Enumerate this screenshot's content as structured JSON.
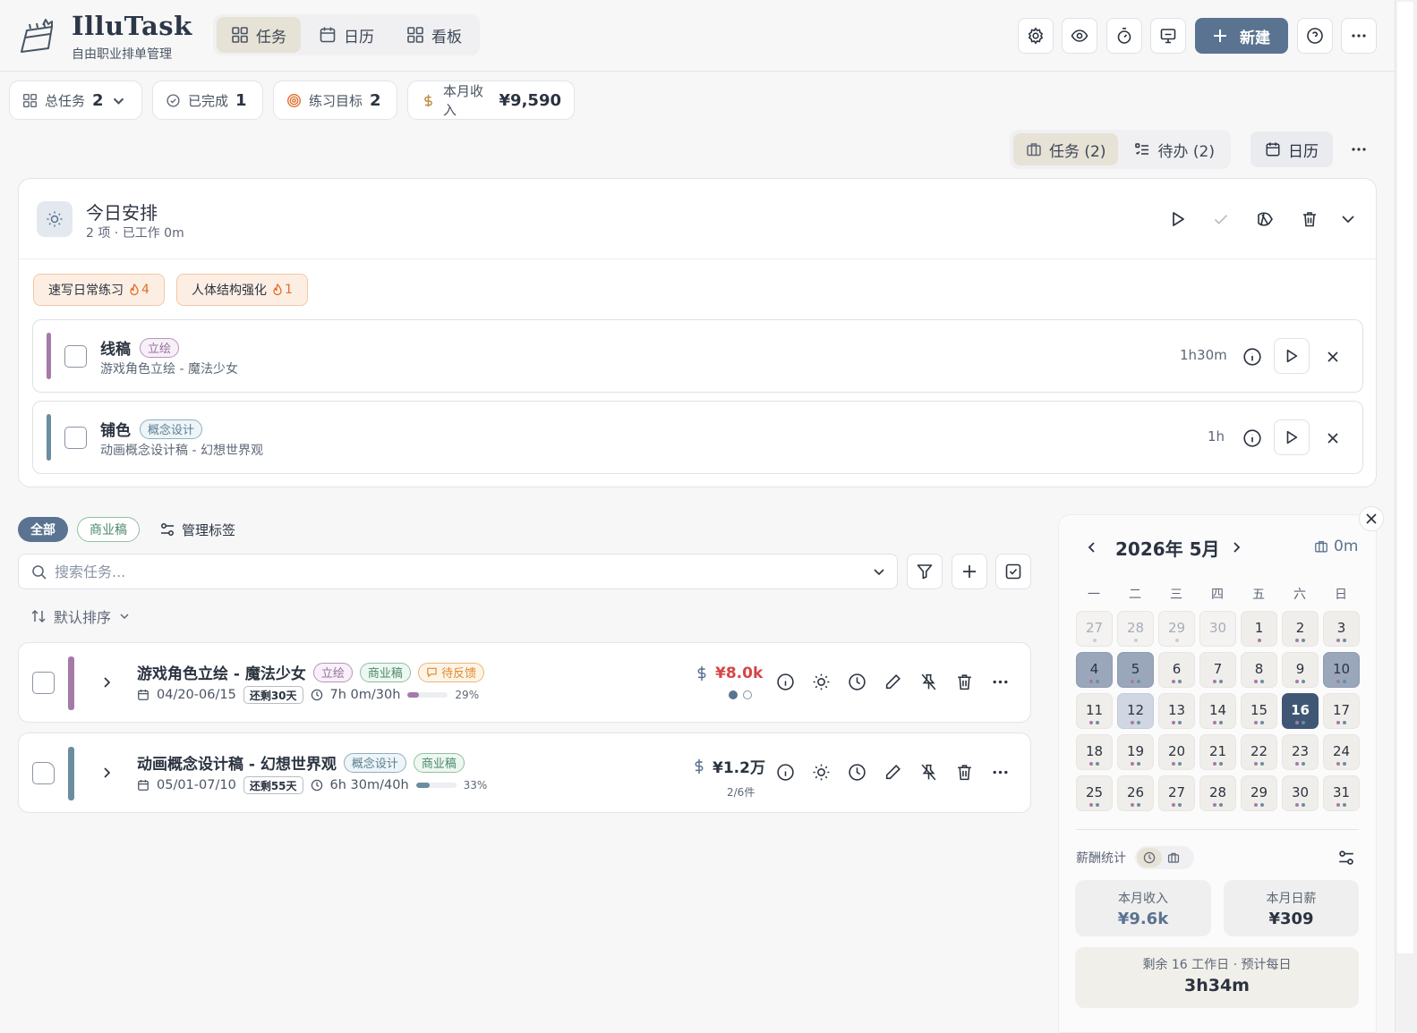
{
  "app": {
    "title": "IlluTask",
    "subtitle": "自由职业排单管理"
  },
  "nav": {
    "tabs": [
      {
        "label": "任务",
        "icon": "grid-icon",
        "active": true
      },
      {
        "label": "日历",
        "icon": "calendar-icon"
      },
      {
        "label": "看板",
        "icon": "board-icon"
      }
    ]
  },
  "toolbar": {
    "new_label": "新建",
    "icons": [
      "gear-icon",
      "eye-icon",
      "timer-icon",
      "presentation-icon",
      "help-icon",
      "more-icon"
    ]
  },
  "stats": [
    {
      "label": "总任务",
      "value": "2"
    },
    {
      "label": "已完成",
      "value": "1"
    },
    {
      "label": "练习目标",
      "value": "2"
    },
    {
      "label": "本月收入",
      "value": "¥9,590"
    }
  ],
  "views": {
    "tasks": "任务 (2)",
    "todos": "待办 (2)",
    "calendar": "日历"
  },
  "today": {
    "title": "今日安排",
    "subtitle": "2 项 · 已工作 0m",
    "habits": [
      {
        "name": "速写日常练习",
        "count": "4"
      },
      {
        "name": "人体结构强化",
        "count": "1"
      }
    ],
    "items": [
      {
        "name": "线稿",
        "tag": "立绘",
        "project": "游戏角色立绘 - 魔法少女",
        "duration": "1h30m",
        "color": "#a57aa9"
      },
      {
        "name": "铺色",
        "tag": "概念设计",
        "project": "动画概念设计稿 - 幻想世界观",
        "duration": "1h",
        "color": "#6b8da0"
      }
    ]
  },
  "filters": {
    "all": "全部",
    "business": "商业稿",
    "manage": "管理标签"
  },
  "search": {
    "placeholder": "搜索任务..."
  },
  "sort": {
    "label": "默认排序"
  },
  "tasks": [
    {
      "title": "游戏角色立绘 - 魔法少女",
      "tags": [
        "立绘",
        "商业稿",
        "待反馈"
      ],
      "dates": "04/20-06/15",
      "remaining": "还剩30天",
      "hours": "7h 0m/30h",
      "progress": 29,
      "progress_label": "29%",
      "price": "¥8.0k",
      "price_color": "#d64545",
      "color": "#a57aa9"
    },
    {
      "title": "动画概念设计稿 - 幻想世界观",
      "tags": [
        "概念设计",
        "商业稿"
      ],
      "dates": "05/01-07/10",
      "remaining": "还剩55天",
      "hours": "6h 30m/40h",
      "progress": 33,
      "progress_label": "33%",
      "price": "¥1.2万",
      "price_sub": "2/6件",
      "price_color": "#2b3340",
      "color": "#6b8da0"
    }
  ],
  "calendar": {
    "month": "2026年 5月",
    "hours": "0m",
    "weekdays": [
      "一",
      "二",
      "三",
      "四",
      "五",
      "六",
      "日"
    ],
    "days": [
      "27",
      "28",
      "29",
      "30",
      "1",
      "2",
      "3",
      "4",
      "5",
      "6",
      "7",
      "8",
      "9",
      "10",
      "11",
      "12",
      "13",
      "14",
      "15",
      "16",
      "17",
      "18",
      "19",
      "20",
      "21",
      "22",
      "23",
      "24",
      "25",
      "26",
      "27",
      "28",
      "29",
      "30",
      "31"
    ]
  },
  "pay": {
    "label": "薪酬统计",
    "income_label": "本月收入",
    "income": "¥9.6k",
    "daily_label": "本月日薪",
    "daily": "¥309",
    "remain_label": "剩余 16 工作日 · 预计每日",
    "remain": "3h34m"
  },
  "colors": {
    "accent": "#5a7390",
    "today": "#3f5775",
    "income": "#5a7390"
  }
}
